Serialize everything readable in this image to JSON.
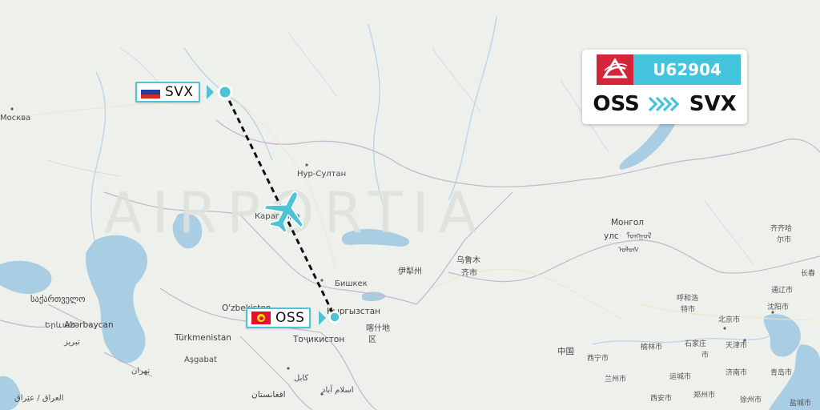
{
  "watermark": "AIRPORTIA",
  "flight": {
    "number": "U62904",
    "origin": "OSS",
    "destination": "SVX",
    "airline_logo_icon": "ural-airlines-logo-icon",
    "route_arrows_icon": "chevron-arrows-icon"
  },
  "airports": {
    "origin": {
      "code": "OSS",
      "flag_icon": "kyrgyzstan-flag-icon"
    },
    "destination": {
      "code": "SVX",
      "flag_icon": "russia-flag-icon"
    }
  },
  "map_labels": {
    "moscow": "Москва",
    "nur_sultan": "Нур-Султан",
    "karaganda": "Караганда",
    "mongolia": "Монгол",
    "mongolia_uls": "улс",
    "bishkek": "Бишкек",
    "kyrgyzstan": "Кыргызстан",
    "tajikistan": "Тоҷикистон",
    "uzbekistan": "O'zbekiston",
    "turkmenistan": "Türkmenistan",
    "ashgabat": "Aşgabat",
    "azerbaycan": "Azərbaycan",
    "yerevan": "Երևան",
    "georgia": "საქართველო",
    "tehran": "تهران",
    "tabriz": "تبریز",
    "iraq": "العراق / عێراق",
    "kabul": "کابل",
    "islamabad": "اسلام آباد",
    "afghanistan": "افغانستان",
    "yining": "伊犁州",
    "urumqi": "乌鲁木",
    "urumqi_2": "齐市",
    "kashgar": "喀什地",
    "kashgar_2": "区",
    "china": "中国",
    "xining": "西宁市",
    "lanzhou": "兰州市",
    "yulin": "榆林市",
    "hohhot": "呼和浩",
    "hohhot_2": "特市",
    "shijiazhuang": "石家庄",
    "shijiazhuang_2": "市",
    "beijing": "北京市",
    "tianjin": "天津市",
    "shenyang": "沈阳市",
    "tongliao": "通辽市",
    "qiqihar": "齐齐哈",
    "qiqihar_2": "尔市",
    "changchun": "长春",
    "yuncheng": "运城市",
    "jinan": "济南市",
    "qingdao": "青岛市",
    "xian": "西安市",
    "zhengzhou": "郑州市",
    "xuzhou": "徐州市",
    "yancheng": "盐城市"
  }
}
